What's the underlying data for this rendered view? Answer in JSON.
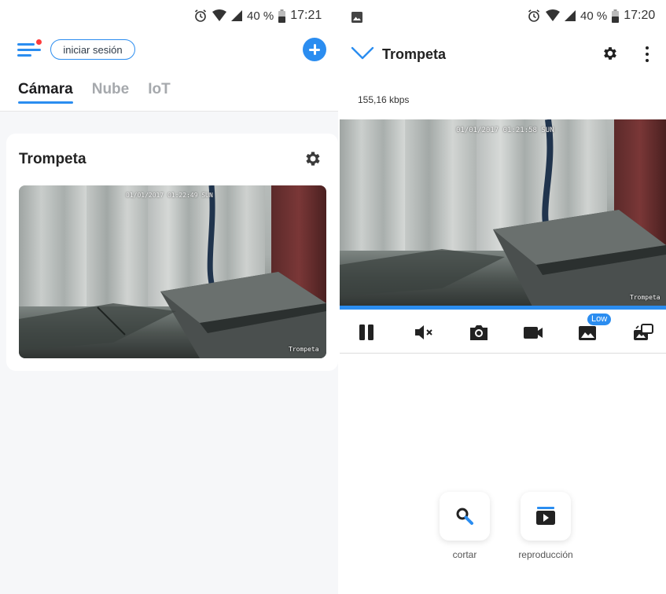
{
  "left": {
    "status_bar": {
      "battery": "40 %",
      "time": "17:21"
    },
    "header": {
      "login_label": "iniciar sesión"
    },
    "tabs": [
      {
        "label": "Cámara",
        "active": true
      },
      {
        "label": "Nube",
        "active": false
      },
      {
        "label": "IoT",
        "active": false
      }
    ],
    "camera_card": {
      "name": "Trompeta",
      "osd_timestamp": "01/01/2017 01:22:49 SUN",
      "overlay_name": "Trompeta"
    }
  },
  "right": {
    "status_bar": {
      "battery": "40 %",
      "time": "17:20"
    },
    "header": {
      "title": "Trompeta"
    },
    "bitrate": "155,16 kbps",
    "live_view": {
      "osd_timestamp": "01/01/2017 01:21:58 SUN",
      "overlay_name": "Trompeta"
    },
    "playback_progress": 1.0,
    "controls": {
      "quality_badge": "Low"
    },
    "tools": [
      {
        "label": "cortar",
        "icon": "search-icon"
      },
      {
        "label": "reproducción",
        "icon": "play-icon"
      }
    ]
  },
  "colors": {
    "accent": "#2b8df0",
    "notification_dot": "#ff3b3b",
    "background": "#f6f7f9"
  }
}
